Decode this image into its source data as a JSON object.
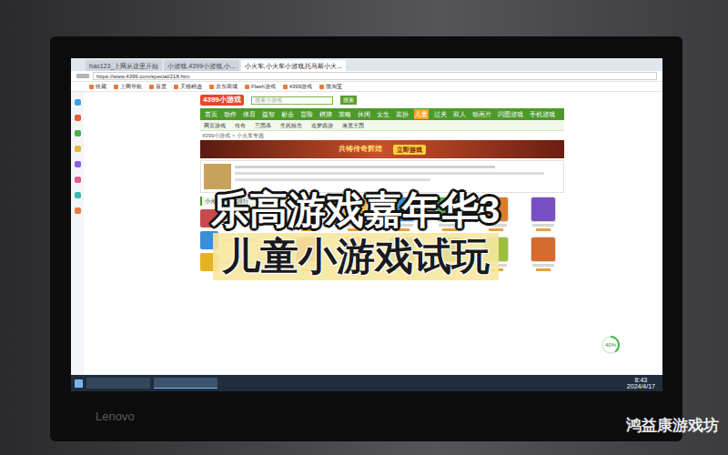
{
  "photo": {
    "watermark": "鸿益康游戏坊",
    "monitor_brand": "Lenovo"
  },
  "overlay": {
    "title": "乐高游戏嘉年华3",
    "subtitle": "儿童小游戏试玩"
  },
  "browser": {
    "tabs": [
      {
        "label": "hao123_上网从这里开始",
        "selected": false
      },
      {
        "label": "小游戏,4399小游戏,小...",
        "selected": false
      },
      {
        "label": "小火车,小火车小游戏,托马斯小火...",
        "selected": true
      }
    ],
    "address": "https://www.4399.com/special/218.htm",
    "bookmarks": [
      "收藏",
      "上网导航",
      "百度",
      "天猫精选",
      "京东商城",
      "Flash游戏",
      "4399游戏",
      "微淘宝"
    ]
  },
  "site": {
    "logo": "4399小游戏",
    "search_placeholder": "搜索小游戏",
    "search_button": "搜索",
    "nav": [
      {
        "label": "首页",
        "selected": false
      },
      {
        "label": "动作",
        "selected": false
      },
      {
        "label": "体育",
        "selected": false
      },
      {
        "label": "益智",
        "selected": false
      },
      {
        "label": "射击",
        "selected": false
      },
      {
        "label": "冒险",
        "selected": false
      },
      {
        "label": "棋牌",
        "selected": false
      },
      {
        "label": "策略",
        "selected": false
      },
      {
        "label": "休闲",
        "selected": false
      },
      {
        "label": "女生",
        "selected": false
      },
      {
        "label": "装扮",
        "selected": false
      },
      {
        "label": "儿童",
        "selected": true
      },
      {
        "label": "过关",
        "selected": false
      },
      {
        "label": "双人",
        "selected": false
      },
      {
        "label": "动画片",
        "selected": false
      },
      {
        "label": "闪图游戏",
        "selected": false
      },
      {
        "label": "手机游戏",
        "selected": false
      }
    ],
    "subnav": [
      "网页游戏",
      "传奇",
      "三国杀",
      "生死狙击",
      "造梦西游",
      "洛克王国"
    ],
    "breadcrumb": "4399小游戏 > 小火车专题",
    "banner": {
      "text": "共铸传奇辉煌",
      "button": "立即游戏"
    },
    "sidebar_title": "小火车小游戏排行",
    "games": [
      {
        "color": "#d83b2f"
      },
      {
        "color": "#f2c14e"
      },
      {
        "color": "#3a8fd6"
      },
      {
        "color": "#5bb04a"
      },
      {
        "color": "#e07b2a"
      },
      {
        "color": "#7a4fc4"
      },
      {
        "color": "#c94a4a"
      },
      {
        "color": "#e6b422"
      },
      {
        "color": "#4aa3a0"
      },
      {
        "color": "#2f7d3a"
      },
      {
        "color": "#9bbf3a"
      },
      {
        "color": "#d66a2f"
      }
    ]
  },
  "speed_ball": {
    "reading": "40%",
    "level": 0.4
  },
  "taskbar": {
    "time": "8:43",
    "date": "2024/4/17"
  }
}
